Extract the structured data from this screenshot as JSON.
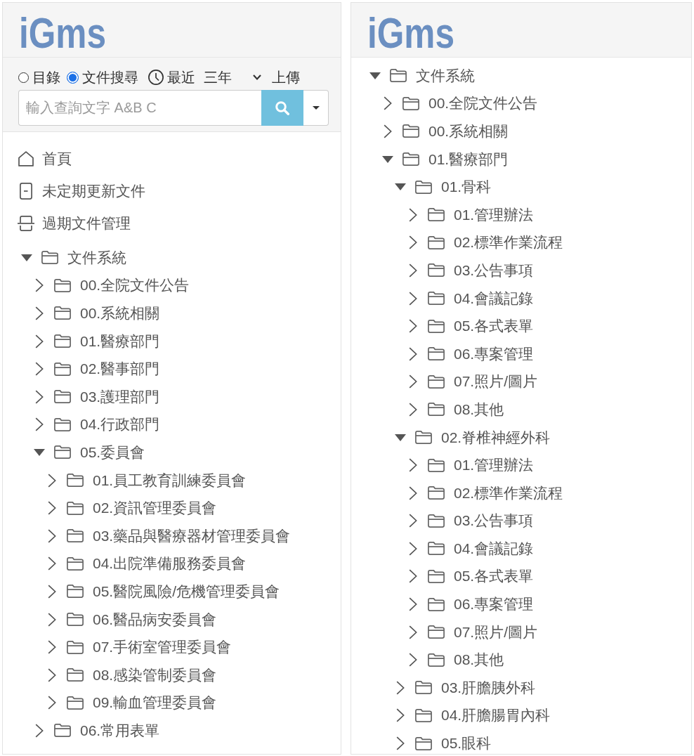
{
  "panels": [
    {
      "logo": "iGms",
      "search": {
        "modes": [
          {
            "label": "目錄",
            "selected": false
          },
          {
            "label": "文件搜尋",
            "selected": true
          }
        ],
        "recent_label": "最近",
        "range": "三年",
        "upload": "上傳",
        "placeholder": "輸入查詢文字 A&B C"
      },
      "nav": [
        {
          "kind": "home",
          "label": "首頁"
        },
        {
          "kind": "document",
          "label": "未定期更新文件"
        },
        {
          "kind": "archive",
          "label": "過期文件管理"
        }
      ],
      "tree": [
        {
          "label": "文件系統",
          "expanded": true,
          "children": [
            {
              "label": "00.全院文件公告",
              "expanded": false
            },
            {
              "label": "00.系統相關",
              "expanded": false
            },
            {
              "label": "01.醫療部門",
              "expanded": false
            },
            {
              "label": "02.醫事部門",
              "expanded": false
            },
            {
              "label": "03.護理部門",
              "expanded": false
            },
            {
              "label": "04.行政部門",
              "expanded": false
            },
            {
              "label": "05.委員會",
              "expanded": true,
              "children": [
                {
                  "label": "01.員工教育訓練委員會",
                  "expanded": false
                },
                {
                  "label": "02.資訊管理委員會",
                  "expanded": false
                },
                {
                  "label": "03.藥品與醫療器材管理委員會",
                  "expanded": false
                },
                {
                  "label": "04.出院準備服務委員會",
                  "expanded": false
                },
                {
                  "label": "05.醫院風險/危機管理委員會",
                  "expanded": false
                },
                {
                  "label": "06.醫品病安委員會",
                  "expanded": false
                },
                {
                  "label": "07.手術室管理委員會",
                  "expanded": false
                },
                {
                  "label": "08.感染管制委員會",
                  "expanded": false
                },
                {
                  "label": "09.輸血管理委員會",
                  "expanded": false
                }
              ]
            },
            {
              "label": "06.常用表單",
              "expanded": false
            }
          ]
        }
      ]
    },
    {
      "logo": "iGms",
      "tree": [
        {
          "label": "文件系統",
          "expanded": true,
          "children": [
            {
              "label": "00.全院文件公告",
              "expanded": false
            },
            {
              "label": "00.系統相關",
              "expanded": false
            },
            {
              "label": "01.醫療部門",
              "expanded": true,
              "children": [
                {
                  "label": "01.骨科",
                  "expanded": true,
                  "children": [
                    {
                      "label": "01.管理辦法",
                      "expanded": false
                    },
                    {
                      "label": "02.標準作業流程",
                      "expanded": false
                    },
                    {
                      "label": "03.公告事項",
                      "expanded": false
                    },
                    {
                      "label": "04.會議記錄",
                      "expanded": false
                    },
                    {
                      "label": "05.各式表單",
                      "expanded": false
                    },
                    {
                      "label": "06.專案管理",
                      "expanded": false
                    },
                    {
                      "label": "07.照片/圖片",
                      "expanded": false
                    },
                    {
                      "label": "08.其他",
                      "expanded": false
                    }
                  ]
                },
                {
                  "label": "02.脊椎神經外科",
                  "expanded": true,
                  "children": [
                    {
                      "label": "01.管理辦法",
                      "expanded": false
                    },
                    {
                      "label": "02.標準作業流程",
                      "expanded": false
                    },
                    {
                      "label": "03.公告事項",
                      "expanded": false
                    },
                    {
                      "label": "04.會議記錄",
                      "expanded": false
                    },
                    {
                      "label": "05.各式表單",
                      "expanded": false
                    },
                    {
                      "label": "06.專案管理",
                      "expanded": false
                    },
                    {
                      "label": "07.照片/圖片",
                      "expanded": false
                    },
                    {
                      "label": "08.其他",
                      "expanded": false
                    }
                  ]
                },
                {
                  "label": "03.肝膽胰外科",
                  "expanded": false
                },
                {
                  "label": "04.肝膽腸胃內科",
                  "expanded": false
                },
                {
                  "label": "05.眼科",
                  "expanded": false
                }
              ]
            }
          ]
        }
      ]
    }
  ]
}
